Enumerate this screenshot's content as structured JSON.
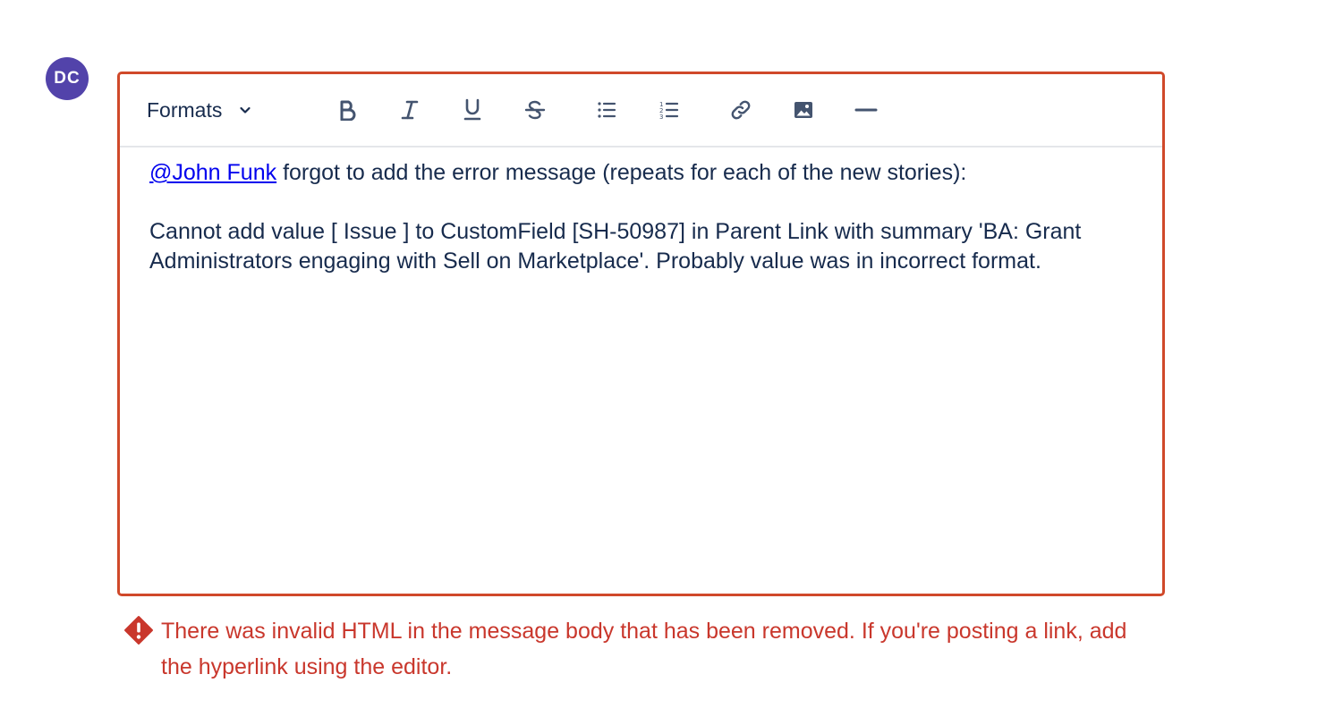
{
  "avatar": {
    "initials": "DC",
    "color": "#5243aa"
  },
  "toolbar": {
    "formats_label": "Formats",
    "buttons": [
      {
        "name": "bold-icon"
      },
      {
        "name": "italic-icon"
      },
      {
        "name": "underline-icon"
      },
      {
        "name": "strikethrough-icon"
      },
      {
        "name": "bullet-list-icon"
      },
      {
        "name": "numbered-list-icon"
      },
      {
        "name": "link-icon"
      },
      {
        "name": "image-icon"
      },
      {
        "name": "horizontal-rule-icon"
      }
    ]
  },
  "editor": {
    "border_color": "#d0492a",
    "mention": "@John Funk",
    "line1_rest": " forgot to add the error message (repeats for each of the new stories):",
    "paragraph2": "Cannot add value [ Issue ] to CustomField [SH-50987] in Parent Link with summary 'BA: Grant Administrators engaging with Sell on Marketplace'. Probably value was in incorrect format."
  },
  "error": {
    "message": "There was invalid HTML in the message body that has been removed. If you're posting a link, add the hyperlink using the editor.",
    "color": "#c9372c"
  }
}
